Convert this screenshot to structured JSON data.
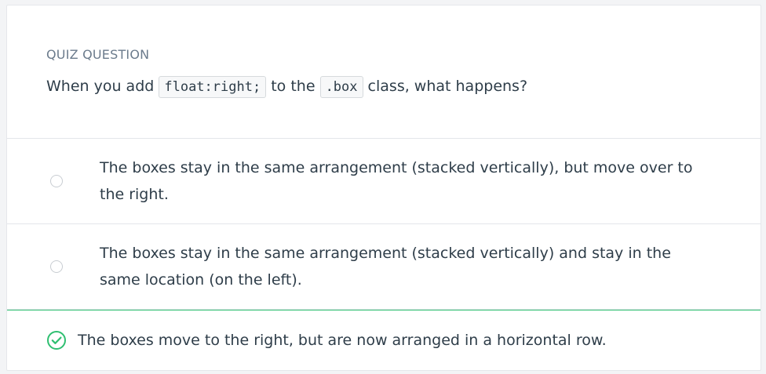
{
  "quiz": {
    "label": "QUIZ QUESTION",
    "prompt": {
      "part1": "When you add ",
      "code1": "float:right;",
      "part2": " to the ",
      "code2": ".box",
      "part3": " class, what happens?"
    },
    "options": [
      {
        "text": "The boxes stay in the same arrangement (stacked vertically), but move over to the right.",
        "state": "unselected"
      },
      {
        "text": "The boxes stay in the same arrangement (stacked vertically) and stay in the same location (on the left).",
        "state": "unselected"
      },
      {
        "text": "The boxes move to the right, but are now arranged in a horizontal row.",
        "state": "correct",
        "icon": "check-circle-icon"
      }
    ]
  },
  "colors": {
    "correct": "#2fbf71",
    "text": "#2e3d49",
    "label": "#6b7b8c"
  }
}
